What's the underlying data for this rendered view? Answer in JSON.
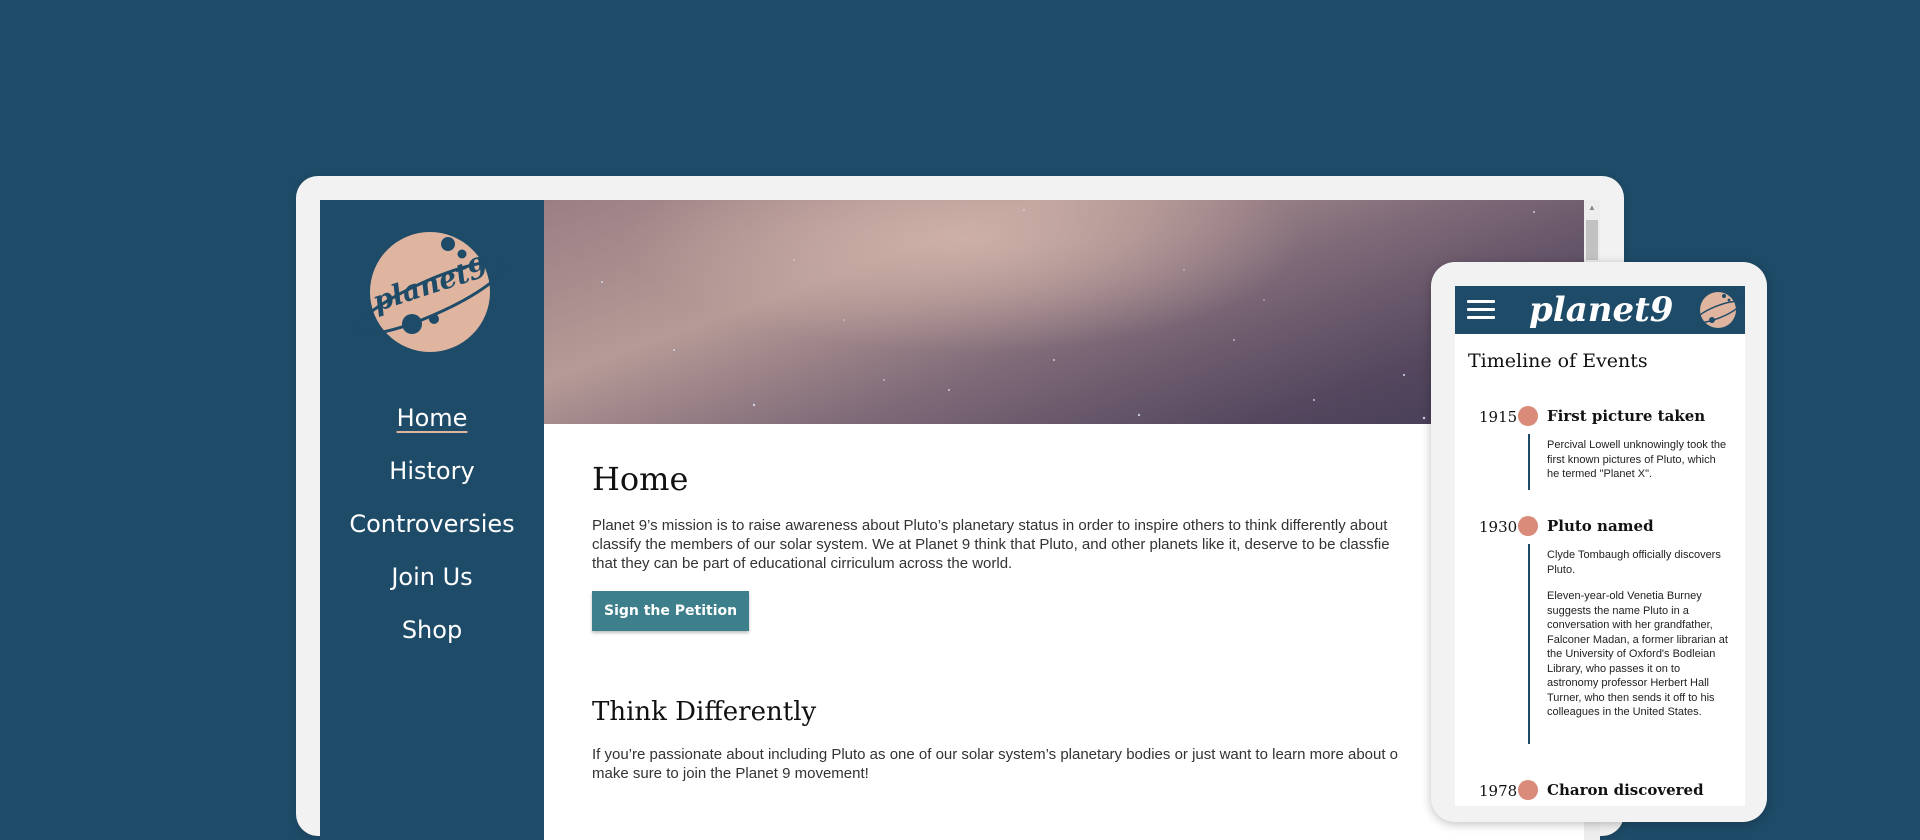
{
  "desktop": {
    "logo_text": "planet9",
    "nav": [
      "Home",
      "History",
      "Controversies",
      "Join Us",
      "Shop"
    ],
    "active_nav": "Home",
    "heading": "Home",
    "intro": "Planet 9’s mission is to raise awareness about Pluto’s planetary status in order to inspire others to think differently about\nclassify the members of our solar system. We at Planet 9 think that Pluto, and other planets like it, deserve to be classfie\nthat they can be part of educational cirriculum across the world.",
    "cta_label": "Sign the Petition",
    "section_heading": "Think Differently",
    "section_text": "If you’re passionate about including Pluto as one of our solar system’s planetary bodies or just want to learn more about o\nmake sure to join the Planet 9 movement!"
  },
  "mobile": {
    "brand": "planet9",
    "timeline_title": "Timeline of Events",
    "events": [
      {
        "year": "1915",
        "heading": "First picture taken",
        "paragraphs": [
          "Percival Lowell unknowingly took the first known pictures of Pluto, which he termed \"Planet X\"."
        ]
      },
      {
        "year": "1930",
        "heading": "Pluto named",
        "paragraphs": [
          "Clyde Tombaugh officially discovers Pluto.",
          "Eleven-year-old Venetia Burney suggests the name Pluto in a conversation with her grandfather, Falconer Madan, a former librarian at the University of Oxford's Bodleian Library, who passes it on to astronomy professor Herbert Hall Turner, who then sends it off to his colleagues in the United States."
        ]
      },
      {
        "year": "1978",
        "heading": "Charon discovered",
        "paragraphs": []
      }
    ]
  },
  "colors": {
    "background": "#1e4b68",
    "accent_pink": "#e0b5a0",
    "button": "#3e7f8c",
    "timeline_dot": "#d98a78"
  }
}
